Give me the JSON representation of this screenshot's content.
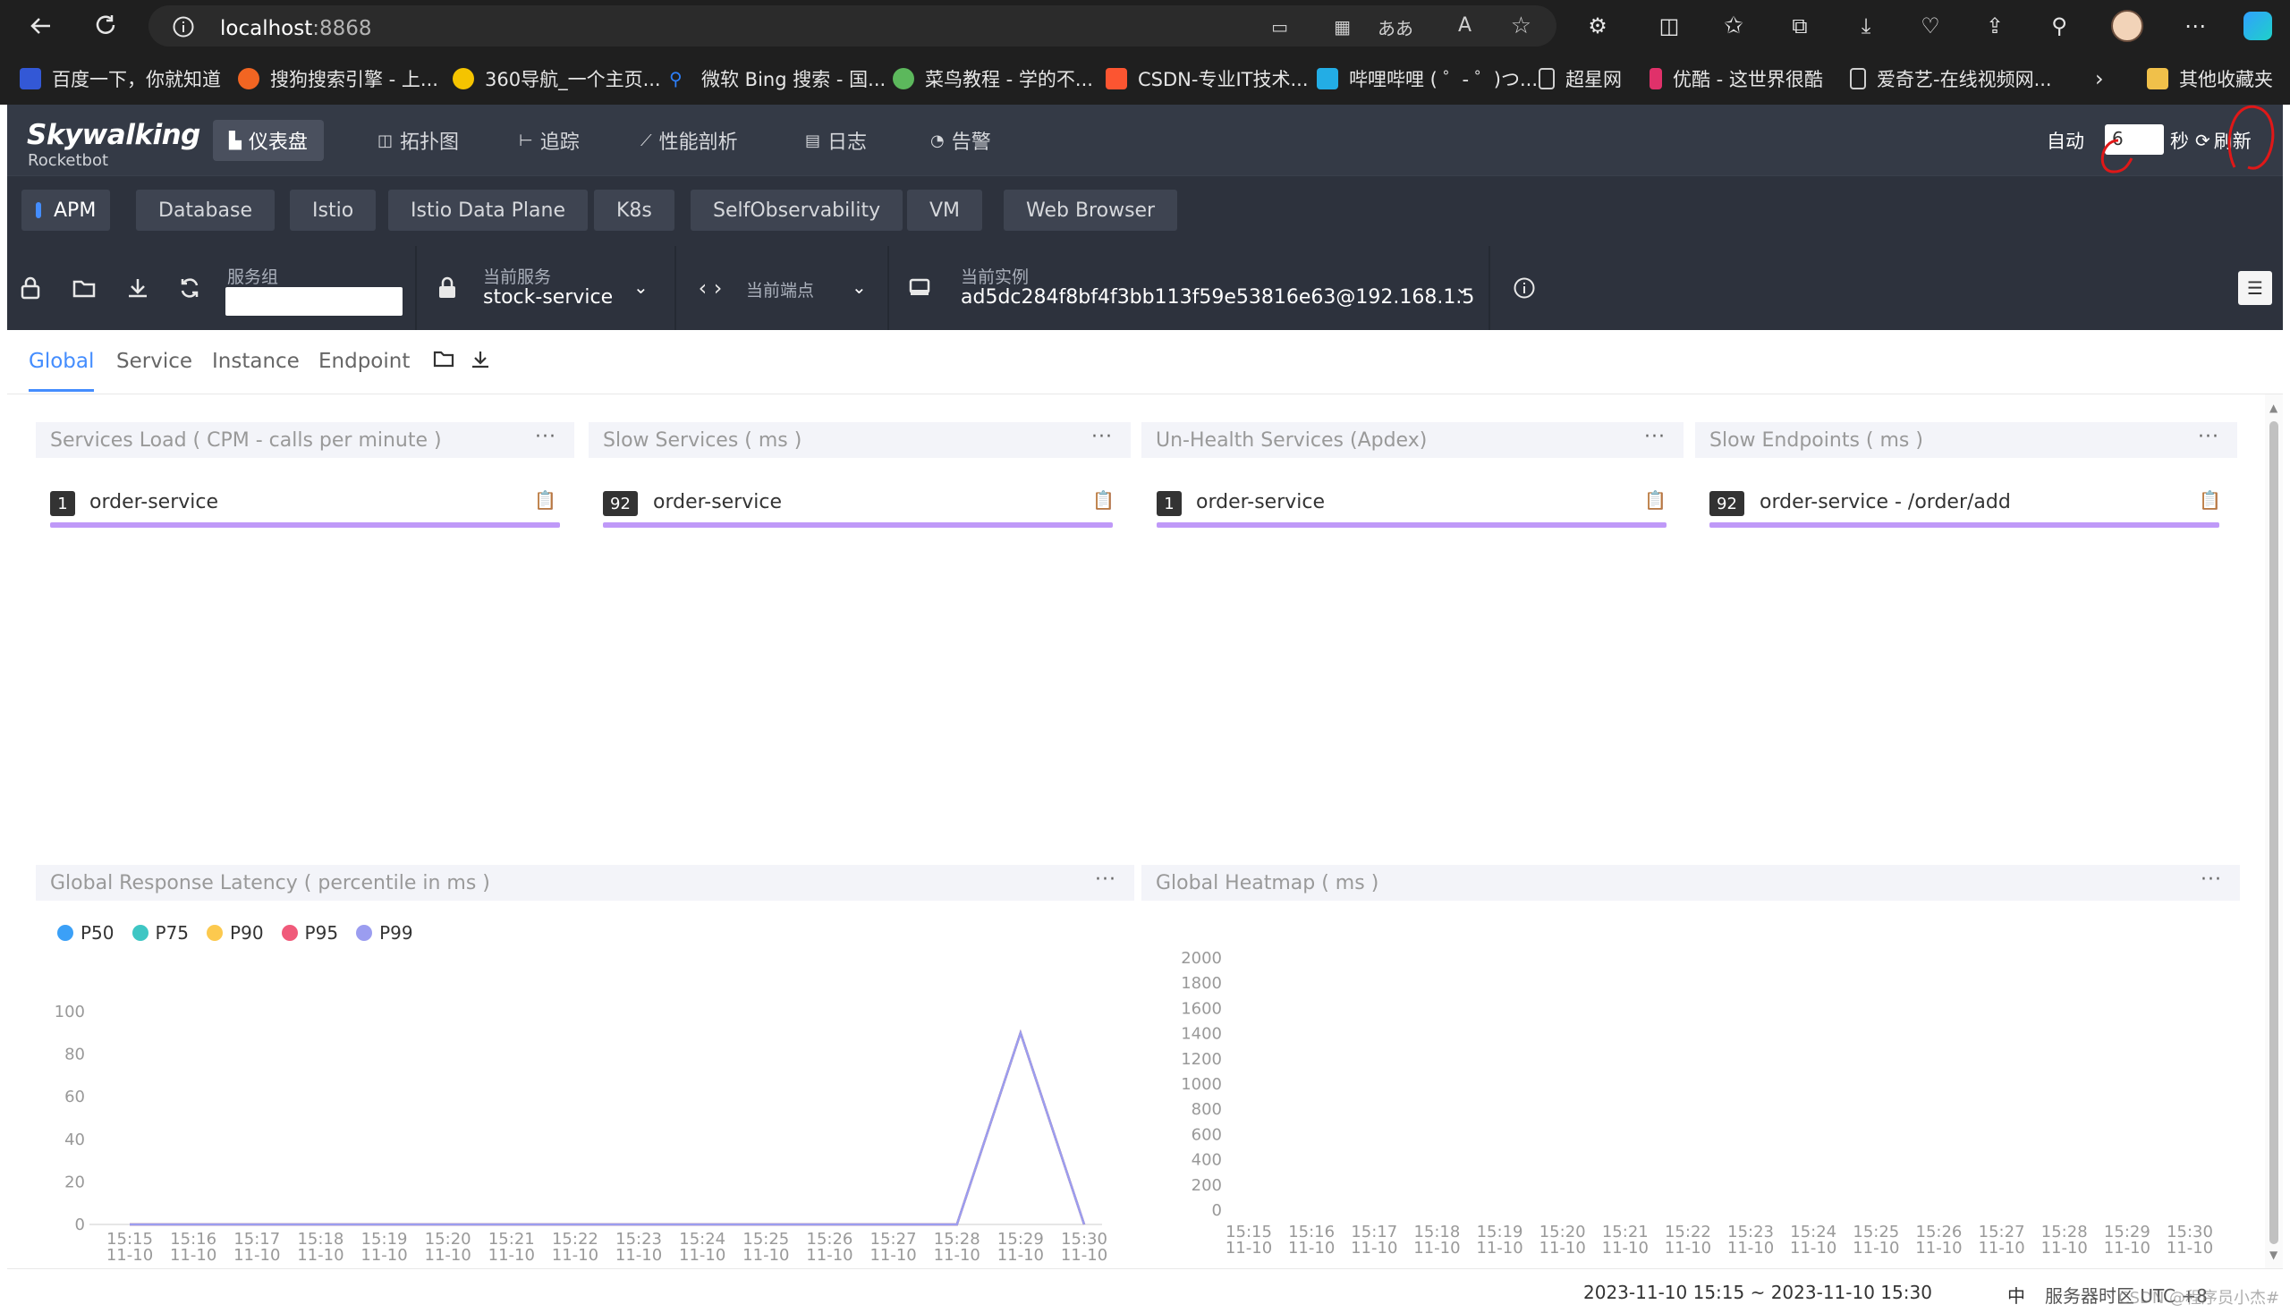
{
  "browser": {
    "url_host": "localhost",
    "url_port": ":8868",
    "bookmarks": [
      {
        "label": "百度一下，你就知道",
        "color": "#3358d6"
      },
      {
        "label": "搜狗搜索引擎 - 上...",
        "color": "#f26522"
      },
      {
        "label": "360导航_一个主页...",
        "color": "#f5c400"
      },
      {
        "label": "微软 Bing 搜索 - 国...",
        "color": "#2d7ff9"
      },
      {
        "label": "菜鸟教程 - 学的不...",
        "color": "#5cb85c"
      },
      {
        "label": "CSDN-专业IT技术...",
        "color": "#fc5531"
      },
      {
        "label": "哔哩哔哩 ( ゜- ゜)つ...",
        "color": "#23ade5"
      },
      {
        "label": "超星网",
        "color": "#cccccc"
      },
      {
        "label": "优酷 - 这世界很酷",
        "color": "#e0316a"
      },
      {
        "label": "爱奇艺-在线视频网...",
        "color": "#cccccc"
      }
    ],
    "other_bookmarks": "其他收藏夹"
  },
  "app": {
    "logo_main": "Skywalking",
    "logo_sub": "Rocketbot",
    "nav": [
      {
        "label": "仪表盘",
        "icon": "dashboard-icon",
        "glyph": "▙"
      },
      {
        "label": "拓扑图",
        "icon": "topology-icon",
        "glyph": "◫"
      },
      {
        "label": "追踪",
        "icon": "trace-icon",
        "glyph": "⊢"
      },
      {
        "label": "性能剖析",
        "icon": "profile-icon",
        "glyph": "⟋"
      },
      {
        "label": "日志",
        "icon": "log-icon",
        "glyph": "▤"
      },
      {
        "label": "告警",
        "icon": "alarm-icon",
        "glyph": "◔"
      }
    ],
    "auto_label": "自动",
    "auto_value": "6",
    "seconds_label": "秒",
    "refresh_label": "刷新"
  },
  "layers": [
    "APM",
    "Database",
    "Istio",
    "Istio Data Plane",
    "K8s",
    "SelfObservability",
    "VM",
    "Web Browser"
  ],
  "selectors": {
    "group_label": "服务组",
    "service_label": "当前服务",
    "service_value": "stock-service",
    "endpoint_label": "当前端点",
    "instance_label": "当前实例",
    "instance_value": "ad5dc284f8bf4f3bb113f59e53816e63@192.168.1.5"
  },
  "tabs": [
    "Global",
    "Service",
    "Instance",
    "Endpoint"
  ],
  "panels": {
    "services_load": {
      "title": "Services Load ( CPM - calls per minute )",
      "badge": "1",
      "name": "order-service"
    },
    "slow_services": {
      "title": "Slow Services ( ms )",
      "badge": "92",
      "name": "order-service"
    },
    "unhealth": {
      "title": "Un-Health Services (Apdex)",
      "badge": "1",
      "name": "order-service"
    },
    "slow_endpoints": {
      "title": "Slow Endpoints ( ms )",
      "badge": "92",
      "name": "order-service - /order/add"
    },
    "latency": {
      "title": "Global Response Latency ( percentile in ms )"
    },
    "heatmap": {
      "title": "Global Heatmap ( ms )"
    }
  },
  "colors": {
    "accent": "#448dfe",
    "bar": "#bf99f8",
    "p50": "#3ba0f7",
    "p75": "#3ec6c4",
    "p90": "#fcc94e",
    "p95": "#f05a7a",
    "p99": "#9b9df0"
  },
  "chart_data": [
    {
      "type": "line",
      "title": "Global Response Latency ( percentile in ms )",
      "x": [
        "15:15\n11-10",
        "15:16\n11-10",
        "15:17\n11-10",
        "15:18\n11-10",
        "15:19\n11-10",
        "15:20\n11-10",
        "15:21\n11-10",
        "15:22\n11-10",
        "15:23\n11-10",
        "15:24\n11-10",
        "15:25\n11-10",
        "15:26\n11-10",
        "15:27\n11-10",
        "15:28\n11-10",
        "15:29\n11-10",
        "15:30\n11-10"
      ],
      "ylim": [
        0,
        100
      ],
      "yticks": [
        0,
        20,
        40,
        60,
        80,
        100
      ],
      "series": [
        {
          "name": "P50",
          "values": [
            0,
            0,
            0,
            0,
            0,
            0,
            0,
            0,
            0,
            0,
            0,
            0,
            0,
            0,
            90,
            0
          ]
        },
        {
          "name": "P75",
          "values": [
            0,
            0,
            0,
            0,
            0,
            0,
            0,
            0,
            0,
            0,
            0,
            0,
            0,
            0,
            90,
            0
          ]
        },
        {
          "name": "P90",
          "values": [
            0,
            0,
            0,
            0,
            0,
            0,
            0,
            0,
            0,
            0,
            0,
            0,
            0,
            0,
            90,
            0
          ]
        },
        {
          "name": "P95",
          "values": [
            0,
            0,
            0,
            0,
            0,
            0,
            0,
            0,
            0,
            0,
            0,
            0,
            0,
            0,
            90,
            0
          ]
        },
        {
          "name": "P99",
          "values": [
            0,
            0,
            0,
            0,
            0,
            0,
            0,
            0,
            0,
            0,
            0,
            0,
            0,
            0,
            90,
            0
          ]
        }
      ],
      "legend_position": "top-left",
      "grid": false
    },
    {
      "type": "heatmap",
      "title": "Global Heatmap ( ms )",
      "x": [
        "15:15\n11-10",
        "15:16\n11-10",
        "15:17\n11-10",
        "15:18\n11-10",
        "15:19\n11-10",
        "15:20\n11-10",
        "15:21\n11-10",
        "15:22\n11-10",
        "15:23\n11-10",
        "15:24\n11-10",
        "15:25\n11-10",
        "15:26\n11-10",
        "15:27\n11-10",
        "15:28\n11-10",
        "15:29\n11-10",
        "15:30\n11-10"
      ],
      "yticks": [
        0,
        200,
        400,
        600,
        800,
        1000,
        1200,
        1400,
        1600,
        1800,
        2000
      ],
      "ylim": [
        0,
        2000
      ],
      "values": []
    }
  ],
  "status": {
    "range": "2023-11-10 15:15 ~ 2023-11-10 15:30",
    "lang": "中",
    "timezone": "服务器时区 UTC +8",
    "watermark": "CSDN @程序员小杰#"
  }
}
